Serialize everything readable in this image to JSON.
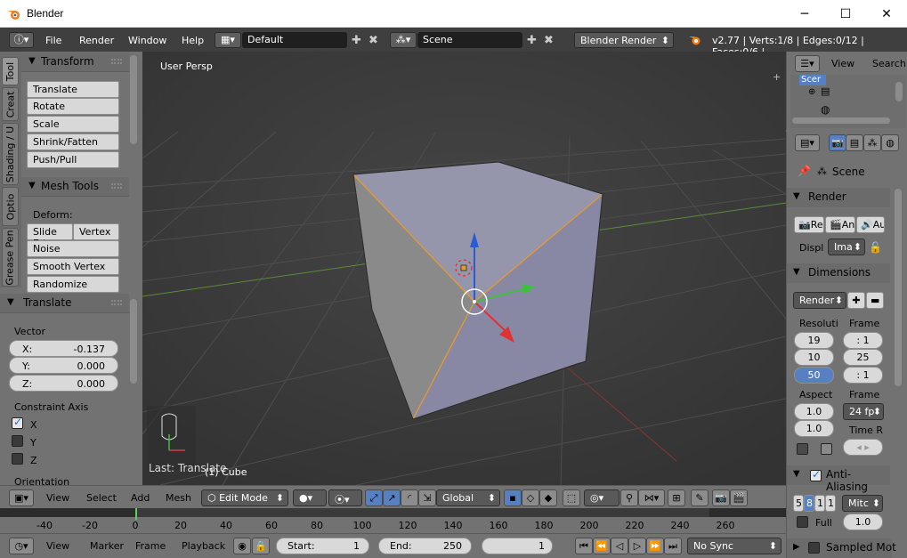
{
  "window": {
    "title": "Blender",
    "minimize": "─",
    "maximize": "☐",
    "close": "✕"
  },
  "info_header": {
    "menus": [
      "File",
      "Render",
      "Window",
      "Help"
    ],
    "layout": "Default",
    "scene": "Scene",
    "engine": "Blender Render",
    "stats": "v2.77 | Verts:1/8 | Edges:0/12 | Faces:0/6 |"
  },
  "tool_tabs": [
    "Tool",
    "Creat",
    "Shading / U",
    "Optio",
    "Grease Pen"
  ],
  "transform_panel": {
    "title": "Transform",
    "buttons": [
      "Translate",
      "Rotate",
      "Scale",
      "Shrink/Fatten",
      "Push/Pull"
    ]
  },
  "mesh_tools_panel": {
    "title": "Mesh Tools",
    "deform_label": "Deform:",
    "slide_edge": "Slide Ed",
    "vertex": "Vertex",
    "buttons": [
      "Noise",
      "Smooth Vertex",
      "Randomize"
    ]
  },
  "translate_panel": {
    "title": "Translate",
    "vector_label": "Vector",
    "x_label": "X:",
    "x_value": "-0.137",
    "y_label": "Y:",
    "y_value": "0.000",
    "z_label": "Z:",
    "z_value": "0.000",
    "constraint_label": "Constraint Axis",
    "axes": [
      "X",
      "Y",
      "Z"
    ],
    "axes_checked": [
      true,
      false,
      false
    ],
    "orientation_label": "Orientation"
  },
  "viewport": {
    "view_name": "User Persp",
    "last_op": "Last: Translate",
    "object_label": "(1) Cube",
    "plus": "+",
    "colors": {
      "bg": "#3b3b3b",
      "grid": "#4e4e4e",
      "cube_front": "#8d8da6",
      "cube_side": "#8b8b8b",
      "cube_top": "#9494a8",
      "edge": "#e69a2e"
    }
  },
  "view3d_header": {
    "menus": [
      "View",
      "Select",
      "Add",
      "Mesh"
    ],
    "mode": "Edit Mode",
    "orientation": "Global"
  },
  "timeline": {
    "ticks": [
      "-40",
      "-20",
      "0",
      "20",
      "40",
      "60",
      "80",
      "100",
      "120",
      "140",
      "160",
      "180",
      "200",
      "220",
      "240",
      "260"
    ],
    "tick_values": [
      -40,
      -20,
      0,
      20,
      40,
      60,
      80,
      100,
      120,
      140,
      160,
      180,
      200,
      220,
      240,
      260
    ],
    "current_frame_value": 1
  },
  "timeline_header": {
    "menus": [
      "View",
      "Marker",
      "Frame",
      "Playback"
    ],
    "start_label": "Start:",
    "start_value": "1",
    "end_label": "End:",
    "end_value": "250",
    "current_frame": "1",
    "sync": "No Sync"
  },
  "outliner": {
    "view": "View",
    "search": "Search",
    "scene_item": "Scer"
  },
  "properties": {
    "context": "Scene",
    "render_panel": "Render",
    "render_btns": [
      "Re",
      "Ani",
      "Au"
    ],
    "display_label": "Displ",
    "display_value": "Ima",
    "dimensions_panel": "Dimensions",
    "preset": "Render",
    "resolution_label": "Resoluti",
    "frame_label": "Frame",
    "res_x": "19",
    "res_y": "10",
    "res_pct": "50",
    "frame_start": ": 1",
    "frame_end": "25",
    "frame_step": ": 1",
    "aspect_label": "Aspect",
    "frame_rate_label": "Frame",
    "aspect_x": "1.0",
    "aspect_y": "1.0",
    "fps": "24 fp",
    "time_label": "Time R",
    "aa_panel": "Anti-Aliasing",
    "aa_samples": [
      "5",
      "8",
      "1",
      "1"
    ],
    "aa_filter": "Mitc",
    "full_label": "Full",
    "aa_size": "1.0",
    "sampled_panel": "Sampled Mot"
  }
}
